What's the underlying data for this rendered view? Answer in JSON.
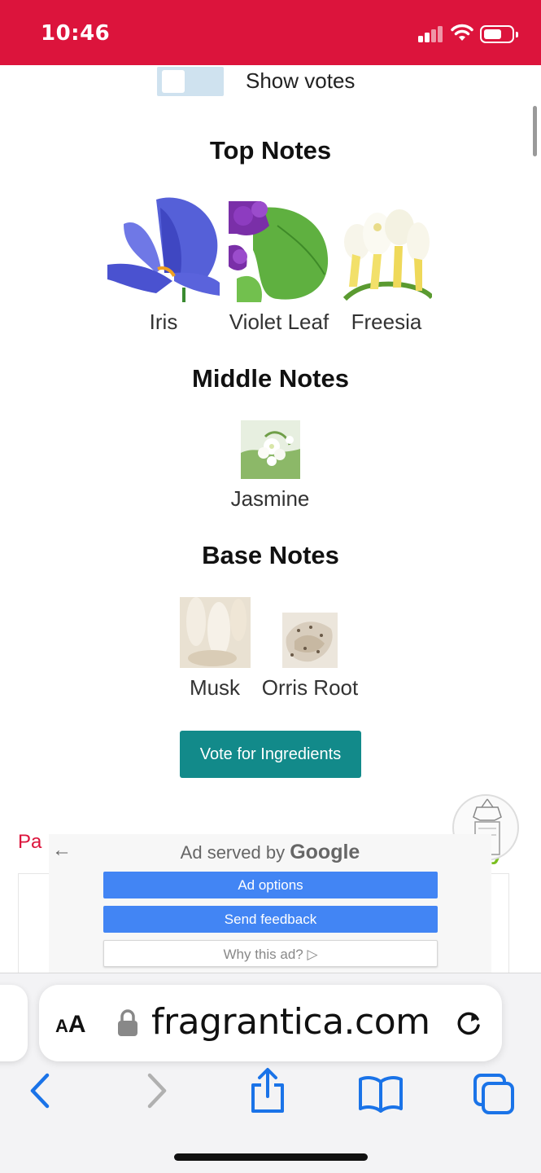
{
  "status": {
    "time": "10:46"
  },
  "votes_toggle": {
    "label": "Show votes"
  },
  "top_notes": {
    "title": "Top Notes",
    "items": [
      {
        "label": "Iris",
        "icon": "iris-flower"
      },
      {
        "label": "Violet Leaf",
        "icon": "violet-leaf"
      },
      {
        "label": "Freesia",
        "icon": "freesia-flower"
      }
    ]
  },
  "middle_notes": {
    "title": "Middle Notes",
    "items": [
      {
        "label": "Jasmine",
        "icon": "jasmine-flower"
      }
    ]
  },
  "base_notes": {
    "title": "Base Notes",
    "items": [
      {
        "label": "Musk",
        "icon": "musk"
      },
      {
        "label": "Orris Root",
        "icon": "orris-root"
      }
    ]
  },
  "vote_button": {
    "label": "Vote for Ingredients"
  },
  "partial_text": {
    "left": "Pa",
    "right": "y"
  },
  "ad": {
    "title_prefix": "Ad served by",
    "title_brand": "Google",
    "back_icon": "back-arrow-icon",
    "options": "Ad options",
    "feedback": "Send feedback",
    "why": "Why this ad? ▷"
  },
  "browser": {
    "aa_label_small": "A",
    "aa_label_large": "A",
    "url": "fragrantica.com"
  }
}
